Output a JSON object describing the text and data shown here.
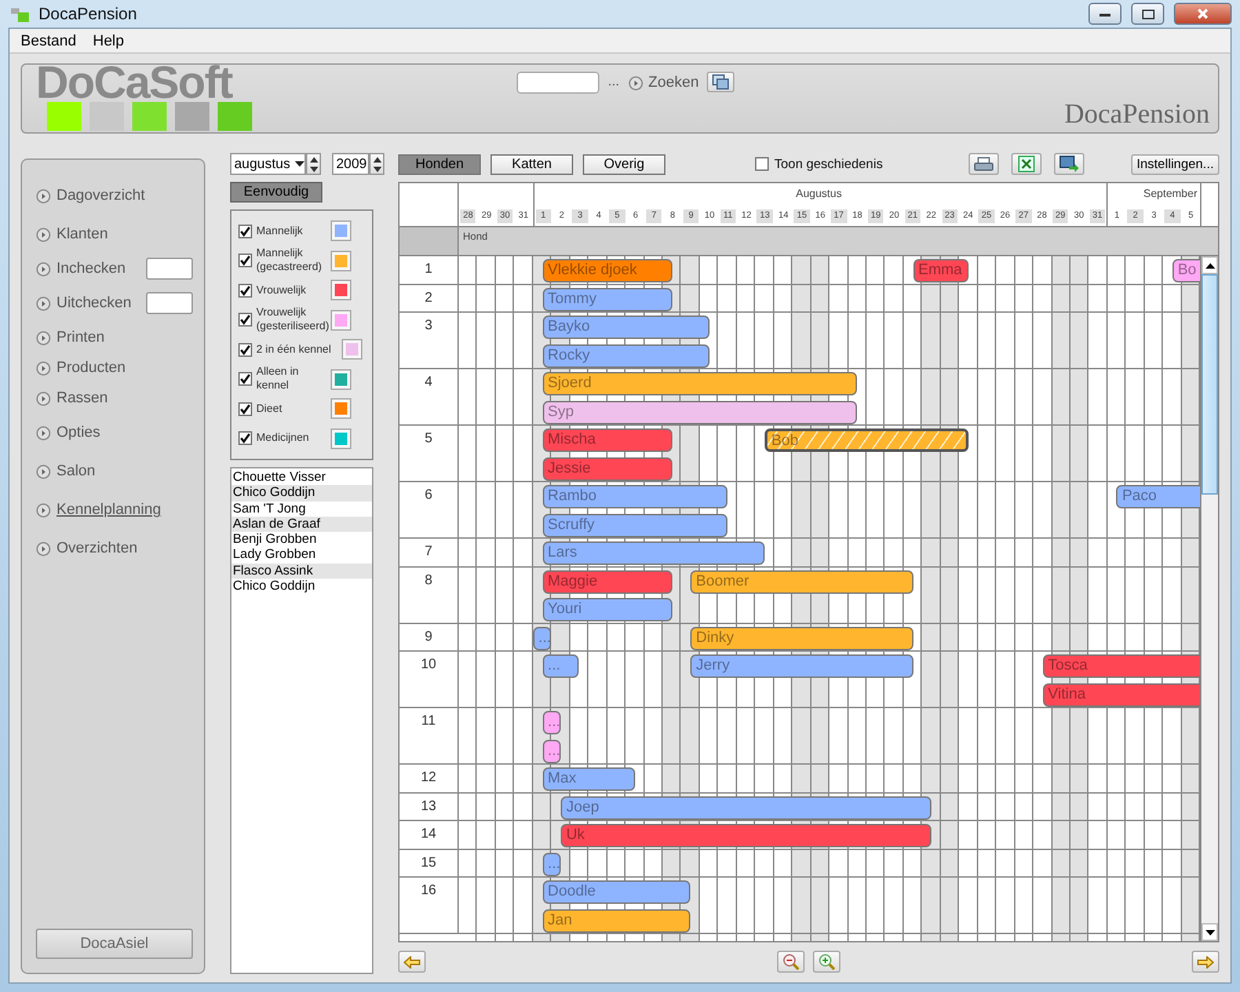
{
  "window": {
    "title": "DocaPension"
  },
  "menu": [
    "Bestand",
    "Help"
  ],
  "header": {
    "logo": "DoCaSoft",
    "ellipsis": "...",
    "search_button": "Zoeken",
    "app_name": "DocaPension"
  },
  "sidebar": {
    "items": [
      {
        "label": "Dagoverzicht",
        "kind": "link",
        "selected": false
      },
      {
        "label": "Klanten",
        "kind": "link",
        "selected": false
      },
      {
        "label": "Inchecken",
        "kind": "field",
        "selected": false
      },
      {
        "label": "Uitchecken",
        "kind": "field",
        "selected": false
      },
      {
        "label": "Printen",
        "kind": "link",
        "selected": false
      },
      {
        "label": "Producten",
        "kind": "link",
        "selected": false
      },
      {
        "label": "Rassen",
        "kind": "link",
        "selected": false
      },
      {
        "label": "Opties",
        "kind": "link",
        "selected": false
      },
      {
        "label": "Salon",
        "kind": "link",
        "selected": false
      },
      {
        "label": "Kennelplanning",
        "kind": "link",
        "selected": true
      },
      {
        "label": "Overzichten",
        "kind": "link",
        "selected": false
      }
    ],
    "bottom_button": "DocaAsiel"
  },
  "controls": {
    "month": "augustus",
    "year": "2009",
    "mode_button": {
      "label": "Eenvoudig",
      "selected": true
    },
    "tabs": [
      {
        "label": "Honden",
        "selected": true
      },
      {
        "label": "Katten",
        "selected": false
      },
      {
        "label": "Overig",
        "selected": false
      }
    ],
    "history": {
      "label": "Toon geschiedenis",
      "checked": false
    },
    "settings_button": "Instellingen..."
  },
  "legend": [
    {
      "label": "Mannelijk",
      "checked": true,
      "color": "#8fb4ff"
    },
    {
      "label": "Mannelijk (gecastreerd)",
      "checked": true,
      "color": "#ffb62e"
    },
    {
      "label": "Vrouwelijk",
      "checked": true,
      "color": "#ff4654"
    },
    {
      "label": "Vrouwelijk (gesteriliseerd)",
      "checked": true,
      "color": "#ffa8f4"
    },
    {
      "label": "2 in één kennel",
      "checked": true,
      "color": "#f0c0ec"
    },
    {
      "label": "Alleen in kennel",
      "checked": true,
      "color": "#20b0a0"
    },
    {
      "label": "Dieet",
      "checked": true,
      "color": "#ff8000"
    },
    {
      "label": "Medicijnen",
      "checked": true,
      "color": "#00c8c8"
    }
  ],
  "clients": [
    {
      "name": "Chouette Visser",
      "highlighted": false
    },
    {
      "name": "Chico Goddijn",
      "highlighted": true
    },
    {
      "name": "Sam 'T Jong",
      "highlighted": false
    },
    {
      "name": "Aslan de Graaf",
      "highlighted": true
    },
    {
      "name": "Benji Grobben",
      "highlighted": false
    },
    {
      "name": "Lady Grobben",
      "highlighted": false
    },
    {
      "name": "Flasco Assink",
      "highlighted": true
    },
    {
      "name": "Chico Goddijn",
      "highlighted": false
    }
  ],
  "planner": {
    "months": [
      {
        "days": [
          {
            "label": "28",
            "weekend": false
          },
          {
            "label": "29",
            "weekend": false
          },
          {
            "label": "30",
            "weekend": false
          },
          {
            "label": "31",
            "weekend": false
          }
        ]
      },
      {
        "label": "Augustus",
        "days": [
          {
            "label": "1",
            "weekend": true
          },
          {
            "label": "2",
            "weekend": true
          },
          {
            "label": "3",
            "weekend": false
          },
          {
            "label": "4",
            "weekend": false
          },
          {
            "label": "5",
            "weekend": false
          },
          {
            "label": "6",
            "weekend": false
          },
          {
            "label": "7",
            "weekend": false
          },
          {
            "label": "8",
            "weekend": true
          },
          {
            "label": "9",
            "weekend": true
          },
          {
            "label": "10",
            "weekend": false
          },
          {
            "label": "11",
            "weekend": false
          },
          {
            "label": "12",
            "weekend": false
          },
          {
            "label": "13",
            "weekend": false
          },
          {
            "label": "14",
            "weekend": false
          },
          {
            "label": "15",
            "weekend": true
          },
          {
            "label": "16",
            "weekend": true
          },
          {
            "label": "17",
            "weekend": false
          },
          {
            "label": "18",
            "weekend": false
          },
          {
            "label": "19",
            "weekend": false
          },
          {
            "label": "20",
            "weekend": false
          },
          {
            "label": "21",
            "weekend": false
          },
          {
            "label": "22",
            "weekend": true
          },
          {
            "label": "23",
            "weekend": true
          },
          {
            "label": "24",
            "weekend": false
          },
          {
            "label": "25",
            "weekend": false
          },
          {
            "label": "26",
            "weekend": false
          },
          {
            "label": "27",
            "weekend": false
          },
          {
            "label": "28",
            "weekend": false
          },
          {
            "label": "29",
            "weekend": true
          },
          {
            "label": "30",
            "weekend": true
          },
          {
            "label": "31",
            "weekend": false
          }
        ]
      },
      {
        "label": "September",
        "days": [
          {
            "label": "1",
            "weekend": false
          },
          {
            "label": "2",
            "weekend": false
          },
          {
            "label": "3",
            "weekend": false
          },
          {
            "label": "4",
            "weekend": false
          },
          {
            "label": "5",
            "weekend": true
          }
        ]
      }
    ],
    "group": "Hond",
    "rows": [
      {
        "number": "1",
        "lanes": [
          [
            {
              "name": "Vlekkie djoek",
              "color": "#ff8000",
              "continues": false,
              "hatched": false
            },
            {
              "name": "Emma",
              "color": "#ff4654",
              "continues": false,
              "hatched": false
            },
            {
              "name": "Bo",
              "color": "#ffa8f4",
              "continues": true,
              "hatched": false
            }
          ]
        ]
      },
      {
        "number": "2",
        "lanes": [
          [
            {
              "name": "Tommy",
              "color": "#8fb4ff",
              "continues": false,
              "hatched": false
            }
          ]
        ]
      },
      {
        "number": "3",
        "lanes": [
          [
            {
              "name": "Bayko",
              "color": "#8fb4ff",
              "continues": false,
              "hatched": false
            }
          ],
          [
            {
              "name": "Rocky",
              "color": "#8fb4ff",
              "continues": false,
              "hatched": false
            }
          ]
        ]
      },
      {
        "number": "4",
        "lanes": [
          [
            {
              "name": "Sjoerd",
              "color": "#ffb62e",
              "continues": false,
              "hatched": false
            }
          ],
          [
            {
              "name": "Syp",
              "color": "#f0c0ec",
              "continues": false,
              "hatched": false
            }
          ]
        ]
      },
      {
        "number": "5",
        "lanes": [
          [
            {
              "name": "Mischa",
              "color": "#ff4654",
              "continues": false,
              "hatched": false
            },
            {
              "name": "Bob",
              "color": "#ffb62e",
              "continues": false,
              "hatched": true
            }
          ],
          [
            {
              "name": "Jessie",
              "color": "#ff4654",
              "continues": false,
              "hatched": false
            }
          ]
        ]
      },
      {
        "number": "6",
        "lanes": [
          [
            {
              "name": "Rambo",
              "color": "#8fb4ff",
              "continues": false,
              "hatched": false
            },
            {
              "name": "Paco",
              "color": "#8fb4ff",
              "continues": true,
              "hatched": false
            }
          ],
          [
            {
              "name": "Scruffy",
              "color": "#8fb4ff",
              "continues": false,
              "hatched": false
            }
          ]
        ]
      },
      {
        "number": "7",
        "lanes": [
          [
            {
              "name": "Lars",
              "color": "#8fb4ff",
              "continues": false,
              "hatched": false
            }
          ]
        ]
      },
      {
        "number": "8",
        "lanes": [
          [
            {
              "name": "Maggie",
              "color": "#ff4654",
              "continues": false,
              "hatched": false
            },
            {
              "name": "Boomer",
              "color": "#ffb62e",
              "continues": false,
              "hatched": false
            }
          ],
          [
            {
              "name": "Youri",
              "color": "#8fb4ff",
              "continues": false,
              "hatched": false
            }
          ]
        ]
      },
      {
        "number": "9",
        "lanes": [
          [
            {
              "name": "...",
              "color": "#8fb4ff",
              "continues": false,
              "hatched": false
            },
            {
              "name": "Dinky",
              "color": "#ffb62e",
              "continues": false,
              "hatched": false
            }
          ]
        ]
      },
      {
        "number": "10",
        "lanes": [
          [
            {
              "name": "...",
              "color": "#8fb4ff",
              "continues": false,
              "hatched": false
            },
            {
              "name": "Jerry",
              "color": "#8fb4ff",
              "continues": false,
              "hatched": false
            },
            {
              "name": "Tosca",
              "color": "#ff4654",
              "continues": true,
              "hatched": false
            }
          ],
          [
            {
              "name": "Vitina",
              "color": "#ff4654",
              "continues": true,
              "hatched": false
            }
          ]
        ]
      },
      {
        "number": "11",
        "lanes": [
          [
            {
              "name": "...",
              "color": "#ffa8f4",
              "continues": false,
              "hatched": false
            }
          ],
          [
            {
              "name": "...",
              "color": "#ffa8f4",
              "continues": false,
              "hatched": false
            }
          ]
        ]
      },
      {
        "number": "12",
        "lanes": [
          [
            {
              "name": "Max",
              "color": "#8fb4ff",
              "continues": false,
              "hatched": false
            }
          ]
        ]
      },
      {
        "number": "13",
        "lanes": [
          [
            {
              "name": "Joep",
              "color": "#8fb4ff",
              "continues": false,
              "hatched": false
            }
          ]
        ]
      },
      {
        "number": "14",
        "lanes": [
          [
            {
              "name": "Uk",
              "color": "#ff4654",
              "continues": false,
              "hatched": false
            }
          ]
        ]
      },
      {
        "number": "15",
        "lanes": [
          [
            {
              "name": "...",
              "color": "#8fb4ff",
              "continues": false,
              "hatched": false
            }
          ]
        ]
      },
      {
        "number": "16",
        "lanes": [
          [
            {
              "name": "Doodle",
              "color": "#8fb4ff",
              "continues": false,
              "hatched": false
            }
          ],
          [
            {
              "name": "Jan",
              "color": "#ffb62e",
              "continues": false,
              "hatched": false
            }
          ]
        ]
      }
    ]
  }
}
